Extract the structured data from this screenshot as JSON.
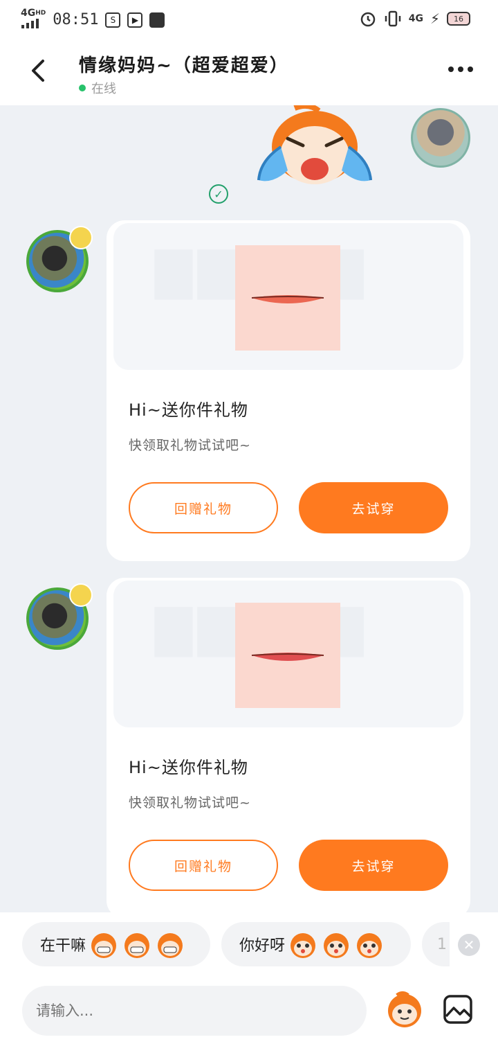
{
  "status_bar": {
    "network": "4G",
    "network_hd": "HD",
    "time": "08:51",
    "network_right": "4G",
    "battery": "16"
  },
  "header": {
    "title": "情缘妈妈~（超爱超爱）",
    "status": "在线"
  },
  "messages": [
    {
      "type": "gift",
      "title": "Hi~送你件礼物",
      "subtitle": "快领取礼物试试吧~",
      "btn_return": "回赠礼物",
      "btn_try": "去试穿"
    },
    {
      "type": "gift",
      "title": "Hi~送你件礼物",
      "subtitle": "快领取礼物试试吧~",
      "btn_return": "回赠礼物",
      "btn_try": "去试穿"
    }
  ],
  "quick_replies": [
    {
      "text": "在干嘛"
    },
    {
      "text": "你好呀"
    },
    {
      "text": "1"
    }
  ],
  "input": {
    "placeholder": "请输入..."
  },
  "colors": {
    "accent": "#ff7a1f",
    "online": "#27c26b",
    "background": "#eef1f5"
  },
  "icons": [
    "back-arrow-icon",
    "more-icon",
    "sent-check-icon",
    "close-icon",
    "emoji-icon",
    "image-icon"
  ]
}
